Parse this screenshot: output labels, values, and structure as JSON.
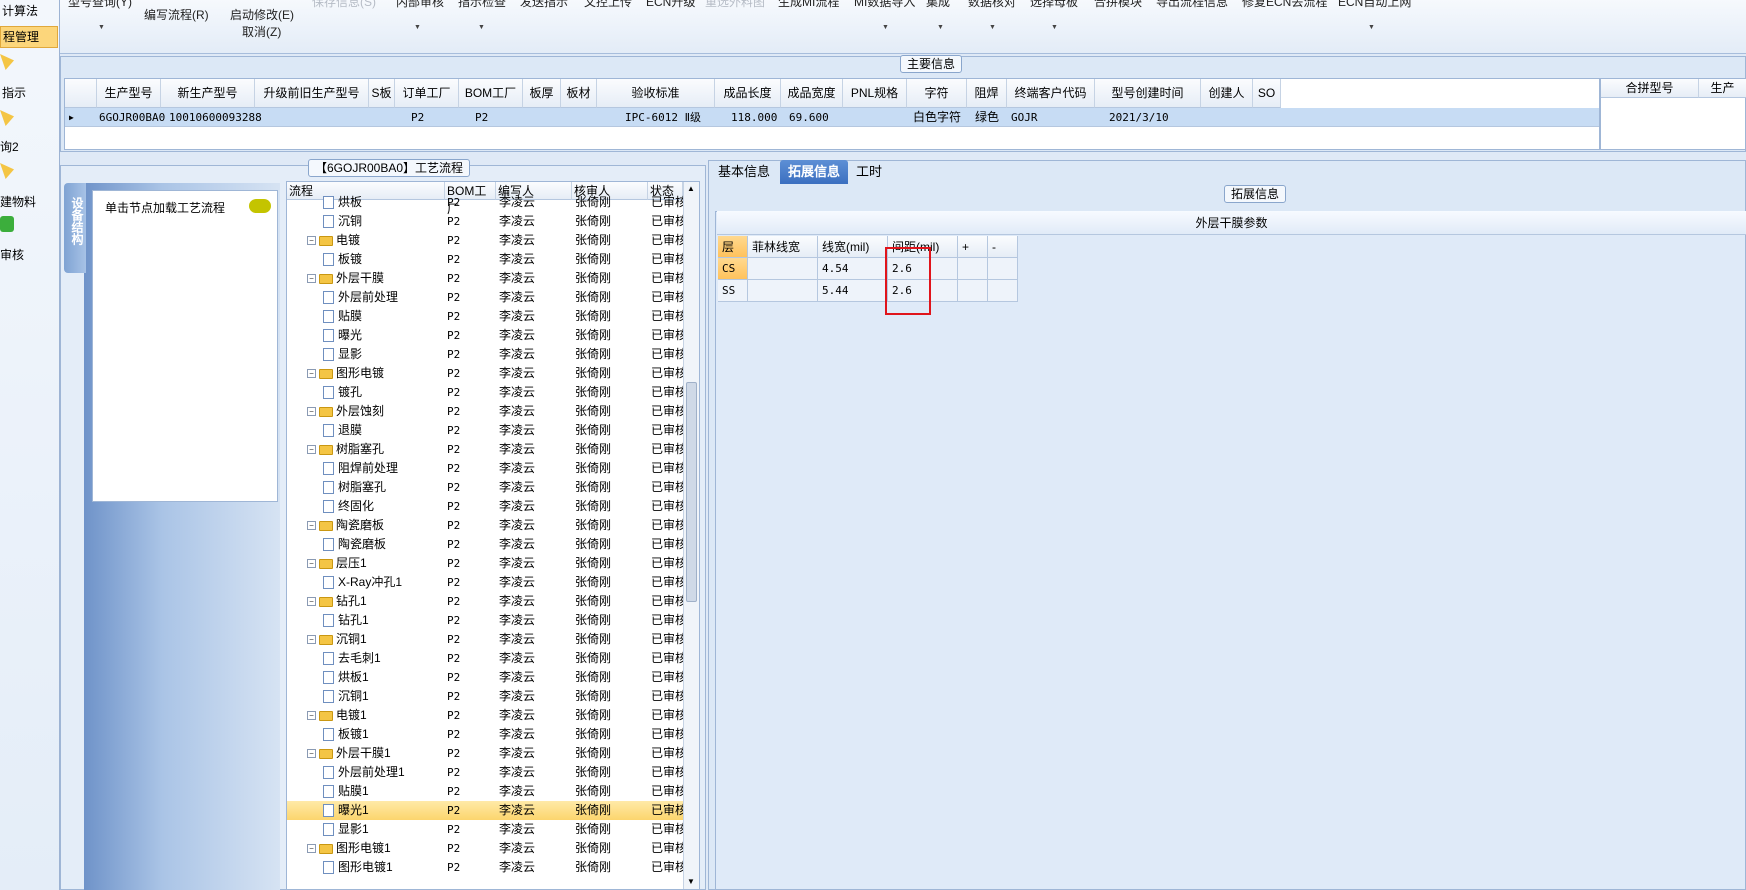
{
  "left_nav": {
    "items": [
      {
        "label": "计算法",
        "selected": false
      },
      {
        "label": "程管理",
        "selected": true
      },
      {
        "label": "指示",
        "selected": false
      },
      {
        "label": "询2",
        "selected": false
      },
      {
        "label": "建物料",
        "selected": false
      },
      {
        "label": "审核",
        "selected": false
      }
    ]
  },
  "toolbar": {
    "items": [
      {
        "label": "型号查询(Y)",
        "ghost": false
      },
      {
        "label": "编写流程(R)",
        "ghost": false
      },
      {
        "label": "启动修改(E)",
        "ghost": false
      },
      {
        "label": "取消(Z)",
        "ghost": false
      },
      {
        "label": "保存信息(S)",
        "ghost": true
      },
      {
        "label": "内部审核",
        "ghost": false
      },
      {
        "label": "指示检查",
        "ghost": false
      },
      {
        "label": "发送指示",
        "ghost": false
      },
      {
        "label": "文控上传",
        "ghost": false
      },
      {
        "label": "ECN升级",
        "ghost": false
      },
      {
        "label": "重选外料图",
        "ghost": true
      },
      {
        "label": "生成MI流程",
        "ghost": false
      },
      {
        "label": "MI数据导入",
        "ghost": false
      },
      {
        "label": "集成",
        "ghost": false
      },
      {
        "label": "数据核对",
        "ghost": false
      },
      {
        "label": "选择母板",
        "ghost": false
      },
      {
        "label": "合拼模块",
        "ghost": false
      },
      {
        "label": "导出流程信息",
        "ghost": false
      },
      {
        "label": "修复ECN丢流程",
        "ghost": false
      },
      {
        "label": "ECN自动上网",
        "ghost": false
      }
    ]
  },
  "main_info": {
    "legend": "主要信息",
    "columns": [
      "生产型号",
      "新生产型号",
      "升级前旧生产型号",
      "S板",
      "订单工厂",
      "BOM工厂",
      "板厚",
      "板材",
      "验收标准",
      "成品长度",
      "成品宽度",
      "PNL规格",
      "字符",
      "阻焊",
      "终端客户代码",
      "型号创建时间",
      "创建人",
      "SO"
    ],
    "row": {
      "c0": "6GOJR00BA0",
      "c1": "10010600093288",
      "c2": "",
      "c3": "",
      "c4": "P2",
      "c5": "P2",
      "c6": "",
      "c7": "",
      "c8": "IPC-6012 Ⅱ级",
      "c9": "118.000",
      "c10": "69.600",
      "c11": "",
      "c12": "白色字符",
      "c13": "绿色",
      "c14": "GOJR",
      "c15": "2021/3/10",
      "c16": "",
      "c17": ""
    },
    "right_columns": [
      "合拼型号",
      "生产"
    ]
  },
  "process": {
    "legend": "【6GOJR00BA0】工艺流程",
    "vertical_tab": "设备结构",
    "load_hint": "单击节点加载工艺流程",
    "columns": [
      "流程",
      "BOM工厂",
      "编写人",
      "核审人",
      "状态"
    ],
    "rows": [
      {
        "name": "烘板",
        "type": "doc",
        "bom": "P2",
        "writer": "李凌云",
        "reviewer": "张倚刚",
        "status": "已审核"
      },
      {
        "name": "沉铜",
        "type": "doc",
        "bom": "P2",
        "writer": "李凌云",
        "reviewer": "张倚刚",
        "status": "已审核"
      },
      {
        "name": "电镀",
        "type": "folder",
        "bom": "P2",
        "writer": "李凌云",
        "reviewer": "张倚刚",
        "status": "已审核"
      },
      {
        "name": "板镀",
        "type": "doc",
        "bom": "P2",
        "writer": "李凌云",
        "reviewer": "张倚刚",
        "status": "已审核"
      },
      {
        "name": "外层干膜",
        "type": "folder",
        "bom": "P2",
        "writer": "李凌云",
        "reviewer": "张倚刚",
        "status": "已审核"
      },
      {
        "name": "外层前处理",
        "type": "doc",
        "bom": "P2",
        "writer": "李凌云",
        "reviewer": "张倚刚",
        "status": "已审核"
      },
      {
        "name": "贴膜",
        "type": "doc",
        "bom": "P2",
        "writer": "李凌云",
        "reviewer": "张倚刚",
        "status": "已审核"
      },
      {
        "name": "曝光",
        "type": "doc",
        "bom": "P2",
        "writer": "李凌云",
        "reviewer": "张倚刚",
        "status": "已审核"
      },
      {
        "name": "显影",
        "type": "doc",
        "bom": "P2",
        "writer": "李凌云",
        "reviewer": "张倚刚",
        "status": "已审核"
      },
      {
        "name": "图形电镀",
        "type": "folder",
        "bom": "P2",
        "writer": "李凌云",
        "reviewer": "张倚刚",
        "status": "已审核"
      },
      {
        "name": "镀孔",
        "type": "doc",
        "bom": "P2",
        "writer": "李凌云",
        "reviewer": "张倚刚",
        "status": "已审核"
      },
      {
        "name": "外层蚀刻",
        "type": "folder",
        "bom": "P2",
        "writer": "李凌云",
        "reviewer": "张倚刚",
        "status": "已审核"
      },
      {
        "name": "退膜",
        "type": "doc",
        "bom": "P2",
        "writer": "李凌云",
        "reviewer": "张倚刚",
        "status": "已审核"
      },
      {
        "name": "树脂塞孔",
        "type": "folder",
        "bom": "P2",
        "writer": "李凌云",
        "reviewer": "张倚刚",
        "status": "已审核"
      },
      {
        "name": "阻焊前处理",
        "type": "doc",
        "bom": "P2",
        "writer": "李凌云",
        "reviewer": "张倚刚",
        "status": "已审核"
      },
      {
        "name": "树脂塞孔",
        "type": "doc",
        "bom": "P2",
        "writer": "李凌云",
        "reviewer": "张倚刚",
        "status": "已审核"
      },
      {
        "name": "终固化",
        "type": "doc",
        "bom": "P2",
        "writer": "李凌云",
        "reviewer": "张倚刚",
        "status": "已审核"
      },
      {
        "name": "陶瓷磨板",
        "type": "folder",
        "bom": "P2",
        "writer": "李凌云",
        "reviewer": "张倚刚",
        "status": "已审核"
      },
      {
        "name": "陶瓷磨板",
        "type": "doc",
        "bom": "P2",
        "writer": "李凌云",
        "reviewer": "张倚刚",
        "status": "已审核"
      },
      {
        "name": "层压1",
        "type": "folder",
        "bom": "P2",
        "writer": "李凌云",
        "reviewer": "张倚刚",
        "status": "已审核"
      },
      {
        "name": "X-Ray冲孔1",
        "type": "doc",
        "bom": "P2",
        "writer": "李凌云",
        "reviewer": "张倚刚",
        "status": "已审核"
      },
      {
        "name": "钻孔1",
        "type": "folder",
        "bom": "P2",
        "writer": "李凌云",
        "reviewer": "张倚刚",
        "status": "已审核"
      },
      {
        "name": "钻孔1",
        "type": "doc",
        "bom": "P2",
        "writer": "李凌云",
        "reviewer": "张倚刚",
        "status": "已审核"
      },
      {
        "name": "沉铜1",
        "type": "folder",
        "bom": "P2",
        "writer": "李凌云",
        "reviewer": "张倚刚",
        "status": "已审核"
      },
      {
        "name": "去毛刺1",
        "type": "doc",
        "bom": "P2",
        "writer": "李凌云",
        "reviewer": "张倚刚",
        "status": "已审核"
      },
      {
        "name": "烘板1",
        "type": "doc",
        "bom": "P2",
        "writer": "李凌云",
        "reviewer": "张倚刚",
        "status": "已审核"
      },
      {
        "name": "沉铜1",
        "type": "doc",
        "bom": "P2",
        "writer": "李凌云",
        "reviewer": "张倚刚",
        "status": "已审核"
      },
      {
        "name": "电镀1",
        "type": "folder",
        "bom": "P2",
        "writer": "李凌云",
        "reviewer": "张倚刚",
        "status": "已审核"
      },
      {
        "name": "板镀1",
        "type": "doc",
        "bom": "P2",
        "writer": "李凌云",
        "reviewer": "张倚刚",
        "status": "已审核"
      },
      {
        "name": "外层干膜1",
        "type": "folder",
        "bom": "P2",
        "writer": "李凌云",
        "reviewer": "张倚刚",
        "status": "已审核"
      },
      {
        "name": "外层前处理1",
        "type": "doc",
        "bom": "P2",
        "writer": "李凌云",
        "reviewer": "张倚刚",
        "status": "已审核"
      },
      {
        "name": "贴膜1",
        "type": "doc",
        "bom": "P2",
        "writer": "李凌云",
        "reviewer": "张倚刚",
        "status": "已审核"
      },
      {
        "name": "曝光1",
        "type": "doc",
        "bom": "P2",
        "writer": "李凌云",
        "reviewer": "张倚刚",
        "status": "已审核",
        "selected": true
      },
      {
        "name": "显影1",
        "type": "doc",
        "bom": "P2",
        "writer": "李凌云",
        "reviewer": "张倚刚",
        "status": "已审核"
      },
      {
        "name": "图形电镀1",
        "type": "folder",
        "bom": "P2",
        "writer": "李凌云",
        "reviewer": "张倚刚",
        "status": "已审核"
      },
      {
        "name": "图形电镀1",
        "type": "doc",
        "bom": "P2",
        "writer": "李凌云",
        "reviewer": "张倚刚",
        "status": "已审核"
      }
    ]
  },
  "detail": {
    "tabs": [
      {
        "label": "基本信息",
        "active": false
      },
      {
        "label": "拓展信息",
        "active": true
      },
      {
        "label": "工时",
        "active": false
      }
    ],
    "legend": "拓展信息",
    "group_title": "外层干膜参数",
    "columns": [
      "层",
      "菲林线宽",
      "线宽(mil)",
      "间距(mil)",
      "+",
      "-"
    ],
    "rows": [
      {
        "layer": "CS",
        "film_width": "",
        "line_width": "4.54",
        "spacing": "2.6"
      },
      {
        "layer": "SS",
        "film_width": "",
        "line_width": "5.44",
        "spacing": "2.6"
      }
    ]
  }
}
